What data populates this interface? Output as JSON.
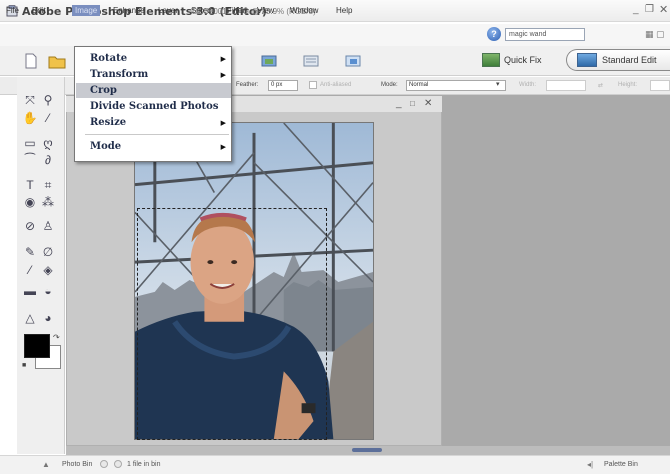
{
  "window": {
    "title": "Adobe Photoshop Elements 3.0 (Editor)",
    "file_info": "DSC00012.JPG @ 23.9% (RGB/8)",
    "min_label": "_",
    "max_label": "❐",
    "close_label": "✕"
  },
  "menubar": {
    "items": [
      "File",
      "Edit",
      "Image",
      "Enhance",
      "Layer",
      "Select",
      "Filter",
      "View",
      "Window",
      "Help"
    ],
    "active": "Image",
    "search_value": "magic wand"
  },
  "image_menu": {
    "items": [
      {
        "label": "Rotate",
        "submenu": true
      },
      {
        "label": "Transform",
        "submenu": true
      },
      {
        "label": "Crop",
        "submenu": false,
        "highlighted": true
      },
      {
        "label": "Divide Scanned Photos",
        "submenu": false
      },
      {
        "label": "Resize",
        "submenu": true
      },
      {
        "label": "Mode",
        "submenu": true
      }
    ]
  },
  "shortcuts": {
    "quick_fix_label": "Quick Fix",
    "standard_edit_label": "Standard Edit"
  },
  "options": {
    "feather_label": "Feather:",
    "feather_value": "0 px",
    "anti_aliased_label": "Anti-aliased",
    "mode_label": "Mode:",
    "mode_value": "Normal",
    "width_label": "Width:",
    "height_label": "Height:"
  },
  "document": {
    "min_label": "_",
    "max_label": "□",
    "close_label": "✕"
  },
  "statusbar": {
    "photo_bin_label": "Photo Bin",
    "file_count": "1 file in bin",
    "palette_bin_label": "Palette Bin"
  },
  "colors": {
    "menu_active_bg": "#7a8ebf",
    "menu_highlight": "#c8cad0",
    "workspace": "#aaaaaa",
    "foreground_color": "#000000",
    "background_color": "#ffffff"
  }
}
